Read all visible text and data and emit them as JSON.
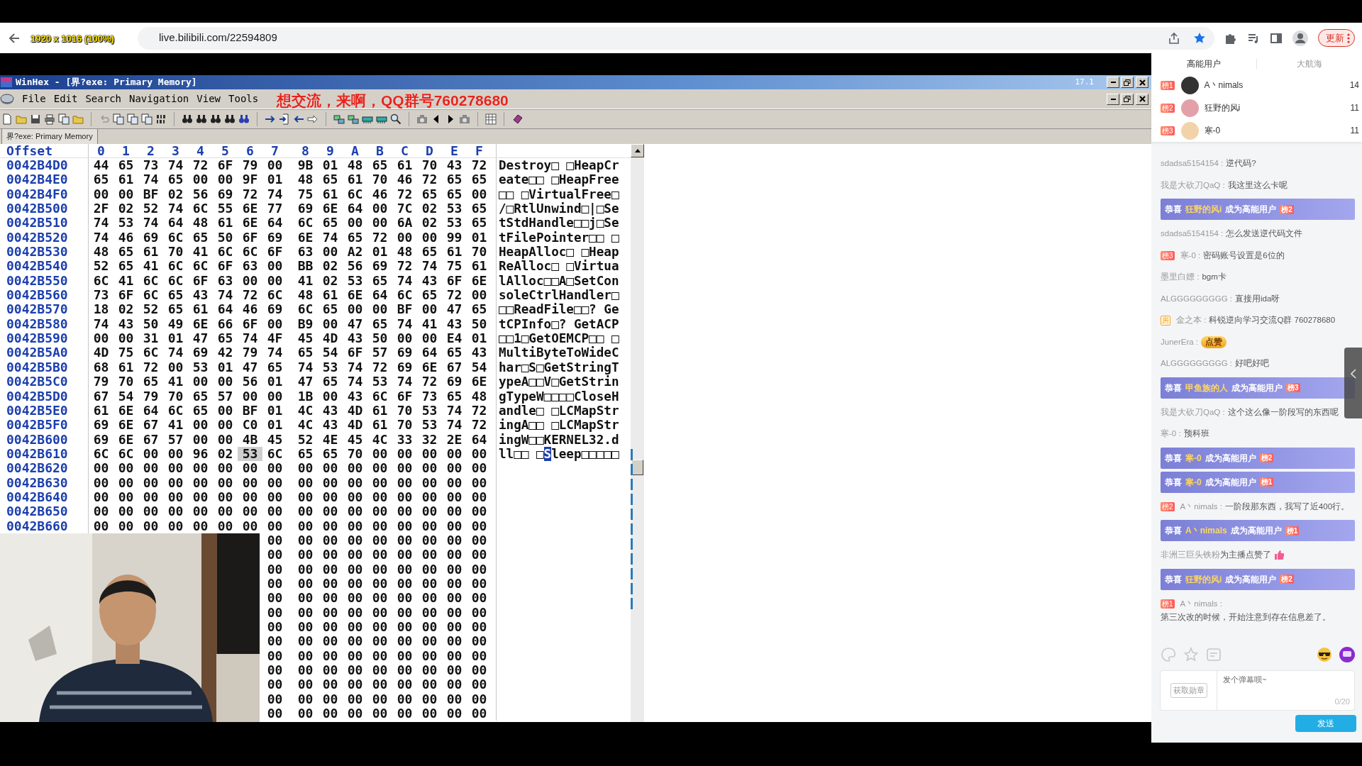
{
  "capture_label": "1920 x 1016 (100%)",
  "browser": {
    "url": "live.bilibili.com/22594809",
    "update_button": "更新"
  },
  "winhex": {
    "title": "WinHex - [界?exe: Primary Memory]",
    "version": "17.1",
    "menu": [
      "File",
      "Edit",
      "Search",
      "Navigation",
      "View",
      "Tools"
    ],
    "tab": {
      "label": "界?exe: Primary Memory",
      "selected": true
    },
    "offset_header": "Offset",
    "columns": [
      "0",
      "1",
      "2",
      "3",
      "4",
      "5",
      "6",
      "7",
      "8",
      "9",
      "A",
      "B",
      "C",
      "D",
      "E",
      "F"
    ],
    "rows": [
      {
        "offset": "0042B4D0",
        "bytes": "44 65 73 74 72 6F 79 00 9B 01 48 65 61 70 43 72",
        "ascii": "Destroy□ □HeapCr"
      },
      {
        "offset": "0042B4E0",
        "bytes": "65 61 74 65 00 00 9F 01 48 65 61 70 46 72 65 65",
        "ascii": "eate□□ □HeapFree"
      },
      {
        "offset": "0042B4F0",
        "bytes": "00 00 BF 02 56 69 72 74 75 61 6C 46 72 65 65 00",
        "ascii": "□□ □VirtualFree□"
      },
      {
        "offset": "0042B500",
        "bytes": "2F 02 52 74 6C 55 6E 77 69 6E 64 00 7C 02 53 65",
        "ascii": "/□RtlUnwind□|□Se"
      },
      {
        "offset": "0042B510",
        "bytes": "74 53 74 64 48 61 6E 64 6C 65 00 00 6A 02 53 65",
        "ascii": "tStdHandle□□j□Se"
      },
      {
        "offset": "0042B520",
        "bytes": "74 46 69 6C 65 50 6F 69 6E 74 65 72 00 00 99 01",
        "ascii": "tFilePointer□□ □"
      },
      {
        "offset": "0042B530",
        "bytes": "48 65 61 70 41 6C 6C 6F 63 00 A2 01 48 65 61 70",
        "ascii": "HeapAlloc□ □Heap"
      },
      {
        "offset": "0042B540",
        "bytes": "52 65 41 6C 6C 6F 63 00 BB 02 56 69 72 74 75 61",
        "ascii": "ReAlloc□ □Virtua"
      },
      {
        "offset": "0042B550",
        "bytes": "6C 41 6C 6C 6F 63 00 00 41 02 53 65 74 43 6F 6E",
        "ascii": "lAlloc□□A□SetCon"
      },
      {
        "offset": "0042B560",
        "bytes": "73 6F 6C 65 43 74 72 6C 48 61 6E 64 6C 65 72 00",
        "ascii": "soleCtrlHandler□"
      },
      {
        "offset": "0042B570",
        "bytes": "18 02 52 65 61 64 46 69 6C 65 00 00 BF 00 47 65",
        "ascii": "□□ReadFile□□? Ge"
      },
      {
        "offset": "0042B580",
        "bytes": "74 43 50 49 6E 66 6F 00 B9 00 47 65 74 41 43 50",
        "ascii": "tCPInfo□? GetACP"
      },
      {
        "offset": "0042B590",
        "bytes": "00 00 31 01 47 65 74 4F 45 4D 43 50 00 00 E4 01",
        "ascii": "□□1□GetOEMCP□□ □"
      },
      {
        "offset": "0042B5A0",
        "bytes": "4D 75 6C 74 69 42 79 74 65 54 6F 57 69 64 65 43",
        "ascii": "MultiByteToWideC"
      },
      {
        "offset": "0042B5B0",
        "bytes": "68 61 72 00 53 01 47 65 74 53 74 72 69 6E 67 54",
        "ascii": "har□S□GetStringT"
      },
      {
        "offset": "0042B5C0",
        "bytes": "79 70 65 41 00 00 56 01 47 65 74 53 74 72 69 6E",
        "ascii": "ypeA□□V□GetStrin"
      },
      {
        "offset": "0042B5D0",
        "bytes": "67 54 79 70 65 57 00 00 1B 00 43 6C 6F 73 65 48",
        "ascii": "gTypeW□□□□CloseH"
      },
      {
        "offset": "0042B5E0",
        "bytes": "61 6E 64 6C 65 00 BF 01 4C 43 4D 61 70 53 74 72",
        "ascii": "andle□ □LCMapStr"
      },
      {
        "offset": "0042B5F0",
        "bytes": "69 6E 67 41 00 00 C0 01 4C 43 4D 61 70 53 74 72",
        "ascii": "ingA□□ □LCMapStr"
      },
      {
        "offset": "0042B600",
        "bytes": "69 6E 67 57 00 00 4B 45 52 4E 45 4C 33 32 2E 64",
        "ascii": "ingW□□KERNEL32.d"
      },
      {
        "offset": "0042B610",
        "bytes": "6C 6C 00 00 96 02 53 6C 65 65 70 00 00 00 00 00",
        "marked_bytes": [
          false,
          false,
          false,
          false,
          false,
          false,
          true,
          false,
          false,
          false,
          false,
          false,
          false,
          false,
          false,
          false
        ],
        "ascii_parts": [
          {
            "text": "ll□□ □",
            "selected": false
          },
          {
            "text": "S",
            "selected": true
          },
          {
            "text": "leep□□□□□",
            "selected": false
          }
        ]
      },
      {
        "offset": "0042B620",
        "bytes": "00 00 00 00 00 00 00 00 00 00 00 00 00 00 00 00"
      },
      {
        "offset": "0042B630",
        "bytes": "00 00 00 00 00 00 00 00 00 00 00 00 00 00 00 00"
      },
      {
        "offset": "0042B640",
        "bytes": "00 00 00 00 00 00 00 00 00 00 00 00 00 00 00 00"
      },
      {
        "offset": "0042B650",
        "bytes": "00 00 00 00 00 00 00 00 00 00 00 00 00 00 00 00"
      },
      {
        "offset": "0042B660",
        "bytes": "00 00 00 00 00 00 00 00 00 00 00 00 00 00 00 00"
      },
      {
        "bytes": "00 00 00 00 00 00 00 00 00"
      },
      {
        "bytes": "00 00 00 00 00 00 00 00 00"
      },
      {
        "bytes": "00 00 00 00 00 00 00 00 00"
      },
      {
        "bytes": "00 00 00 00 00 00 00 00 00"
      },
      {
        "bytes": "00 00 00 00 00 00 00 00 00"
      },
      {
        "bytes": "00 00 00 00 00 00 00 00 00"
      },
      {
        "bytes": "00 00 00 00 00 00 00 00 00"
      },
      {
        "bytes": "00 00 00 00 00 00 00 00 00"
      },
      {
        "bytes": "00 00 00 00 00 00 00 00 00"
      },
      {
        "bytes": "00 00 00 00 00 00 00 00 00"
      },
      {
        "bytes": "00 00 00 00 00 00 00 00 00"
      },
      {
        "bytes": "00 00 00 00 00 00 00 00 00"
      },
      {
        "bytes": "00 00 00 00 00 00 00 00 00"
      }
    ]
  },
  "stream_overlay": "想交流，来啊，QQ群号760278680",
  "sidebar": {
    "tabs": [
      {
        "label": "高能用户",
        "selected": true
      },
      {
        "label": "大航海",
        "selected": false
      }
    ],
    "ranking": [
      {
        "badge": "榜1",
        "name": "A丶nimals",
        "score": "14"
      },
      {
        "badge": "榜2",
        "name": "狂野的风i",
        "score": "11"
      },
      {
        "badge": "榜3",
        "name": "寒-0",
        "score": "11"
      }
    ],
    "chat": [
      {
        "kind": "message",
        "user": "sdadsa5154154 :",
        "text": "逆代码?"
      },
      {
        "kind": "message",
        "user": "我是大砍刀QaQ :",
        "text": "我这里这么卡呢"
      },
      {
        "kind": "banner",
        "prefix": "恭喜",
        "user": "狂野的风i",
        "suffix": "成为高能用户",
        "badge": "榜2"
      },
      {
        "kind": "message",
        "user": "sdadsa5154154 :",
        "text": "怎么发送逆代码文件"
      },
      {
        "kind": "message",
        "badge": {
          "kind": "rank",
          "text": "榜3"
        },
        "user": "寒-0 :",
        "text": "密码账号设置是6位的"
      },
      {
        "kind": "message",
        "user": "墨里白嫖 :",
        "text": "bgm卡"
      },
      {
        "kind": "message",
        "user": "ALGGGGGGGGG :",
        "text": "直接用ida呀"
      },
      {
        "kind": "message",
        "badge": {
          "kind": "admin",
          "text": "房"
        },
        "user": "金之本 :",
        "text": "科锐逆向学习交流Q群 760278680"
      },
      {
        "kind": "sticker",
        "user": "JunerEra :",
        "sticker": "点赞"
      },
      {
        "kind": "message",
        "user": "ALGGGGGGGGG :",
        "text": "好吧好吧"
      },
      {
        "kind": "banner",
        "prefix": "恭喜",
        "user": "甲鱼族的人",
        "suffix": "成为高能用户",
        "badge": "榜3"
      },
      {
        "kind": "message",
        "user": "我是大砍刀QaQ :",
        "text": "这个这么像一阶段写的东西呢"
      },
      {
        "kind": "message",
        "user": "寒-0 :",
        "text": "预科班"
      },
      {
        "kind": "banner",
        "prefix": "恭喜",
        "user": "寒-0",
        "suffix": "成为高能用户",
        "badge": "榜2"
      },
      {
        "kind": "banner",
        "prefix": "恭喜",
        "user": "寒-0",
        "suffix": "成为高能用户",
        "badge": "榜1"
      },
      {
        "kind": "message",
        "badge": {
          "kind": "rank",
          "text": "榜2"
        },
        "user": "A丶nimals :",
        "text": "一阶段那东西，我写了近400行。"
      },
      {
        "kind": "banner",
        "prefix": "恭喜",
        "user": "A丶nimals",
        "suffix": "成为高能用户",
        "badge": "榜1"
      },
      {
        "kind": "like",
        "user": "非洲三巨头铁粉",
        "text": "为主播点赞了"
      },
      {
        "kind": "banner",
        "prefix": "恭喜",
        "user": "狂野的风i",
        "suffix": "成为高能用户",
        "badge": "榜2"
      },
      {
        "kind": "message",
        "badge": {
          "kind": "rank",
          "text": "榜1"
        },
        "user": "A丶nimals :",
        "text": "第三次改的时候，开始注意到存在信息差了。"
      }
    ],
    "input": {
      "medal_button": "获取勋章",
      "placeholder": "发个弹幕呗~",
      "counter": "0/20",
      "send_button": "发送"
    }
  }
}
